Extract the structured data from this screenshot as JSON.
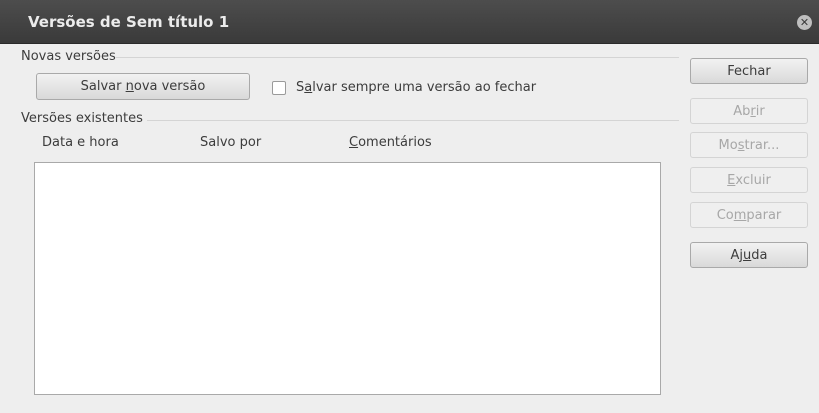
{
  "window": {
    "title": "Versões de Sem título 1",
    "close_icon": "close-icon"
  },
  "new_versions": {
    "group_label": "Novas versões",
    "save_button": {
      "pre": "Salvar ",
      "accel": "n",
      "post": "ova versão"
    },
    "always_save_checkbox": {
      "checked": false,
      "pre": "S",
      "accel": "a",
      "post": "lvar sempre uma versão ao fechar"
    }
  },
  "existing_versions": {
    "group_label": "Versões existentes",
    "columns": [
      {
        "pre": "",
        "accel": "",
        "post": "Data e hora"
      },
      {
        "pre": "",
        "accel": "",
        "post": "Salvo por"
      },
      {
        "pre": "",
        "accel": "C",
        "post": "omentários"
      }
    ],
    "rows": []
  },
  "side_buttons": [
    {
      "pre": "Fechar",
      "accel": "",
      "post": "",
      "enabled": true
    },
    {
      "pre": "Ab",
      "accel": "r",
      "post": "ir",
      "enabled": false
    },
    {
      "pre": "Mo",
      "accel": "s",
      "post": "trar...",
      "enabled": false
    },
    {
      "pre": "",
      "accel": "E",
      "post": "xcluir",
      "enabled": false
    },
    {
      "pre": "Co",
      "accel": "m",
      "post": "parar",
      "enabled": false
    },
    {
      "pre": "Aj",
      "accel": "u",
      "post": "da",
      "enabled": true
    }
  ],
  "colors": {
    "titlebar": "#3f3f3f",
    "dialog_bg": "#eeeeee",
    "disabled_text": "#a7a7a7"
  }
}
